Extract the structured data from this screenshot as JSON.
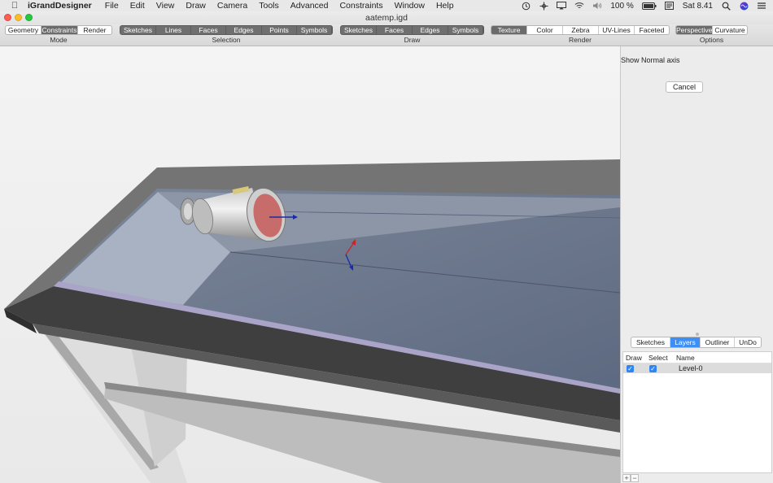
{
  "menubar": {
    "app_name": "iGrandDesigner",
    "menus": [
      "File",
      "Edit",
      "View",
      "Draw",
      "Camera",
      "Tools",
      "Advanced",
      "Constraints",
      "Window",
      "Help"
    ],
    "battery": "100 %",
    "clock": "Sat 8.41"
  },
  "window": {
    "title": "aatemp.igd"
  },
  "toolbar": {
    "mode": {
      "label": "Mode",
      "buttons": [
        "Geometry",
        "Constraints",
        "Render"
      ],
      "active": "Constraints"
    },
    "selection": {
      "label": "Selection",
      "buttons": [
        "Sketches",
        "Lines",
        "Faces",
        "Edges",
        "Points",
        "Symbols"
      ]
    },
    "draw": {
      "label": "Draw",
      "buttons": [
        "Sketches",
        "Faces",
        "Edges",
        "Symbols"
      ]
    },
    "render": {
      "label": "Render",
      "buttons": [
        "Texture",
        "Color",
        "Zebra",
        "UV-Lines",
        "Faceted"
      ],
      "active": "Texture"
    },
    "options": {
      "label": "Options",
      "buttons": [
        "Perspective",
        "Curvature"
      ],
      "active": "Perspective"
    }
  },
  "panel": {
    "prompt": "Show Normal axis",
    "cancel": "Cancel",
    "tabs": [
      "Sketches",
      "Layers",
      "Outliner",
      "UnDo"
    ],
    "active_tab": "Layers",
    "layers": {
      "columns": [
        "Draw",
        "Select",
        "Name"
      ],
      "rows": [
        {
          "draw": true,
          "select": true,
          "name": "Level-0"
        }
      ]
    },
    "add": "+",
    "remove": "−"
  },
  "colors": {
    "active_segment": "#6b6b6b",
    "accent": "#3d8ef5",
    "tray_interior": "#6b7688",
    "frame": "#5a5a5a"
  }
}
